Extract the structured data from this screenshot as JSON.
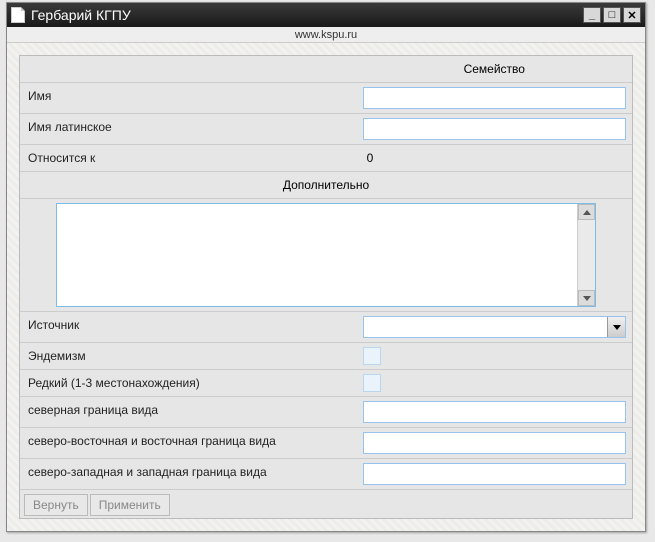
{
  "window": {
    "title": "Гербарий КГПУ",
    "subtitle": "www.kspu.ru"
  },
  "headers": {
    "family": "Семейство",
    "additional": "Дополнительно"
  },
  "fields": {
    "name_label": "Имя",
    "name_value": "",
    "latin_label": "Имя латинское",
    "latin_value": "",
    "belongs_label": "Относится к",
    "belongs_value": "0",
    "additional_value": "",
    "source_label": "Источник",
    "source_value": "",
    "endemism_label": "Эндемизм",
    "rare_label": "Редкий (1-3 местонахождения)",
    "north_label": "северная граница вида",
    "north_value": "",
    "northeast_label": "северо-восточная и восточная граница вида",
    "northeast_value": "",
    "northwest_label": "северо-западная и западная граница вида",
    "northwest_value": ""
  },
  "buttons": {
    "revert": "Вернуть",
    "apply": "Применить"
  }
}
